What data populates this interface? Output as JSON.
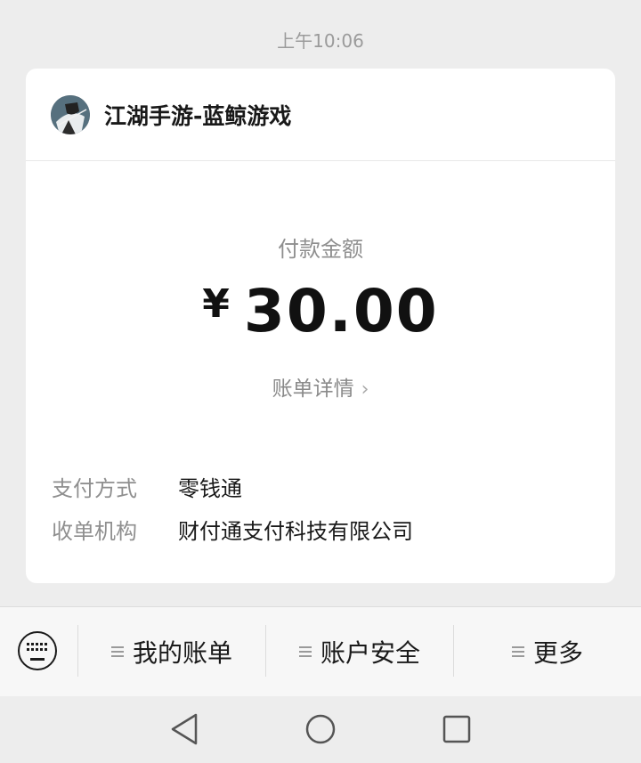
{
  "message": {
    "time": "上午10:06"
  },
  "merchant": {
    "name": "江湖手游-蓝鲸游戏"
  },
  "payment": {
    "amount_label": "付款金额",
    "currency_symbol": "¥",
    "amount": "30.00",
    "bill_details_link": "账单详情"
  },
  "info": [
    {
      "key": "支付方式",
      "value": "零钱通"
    },
    {
      "key": "收单机构",
      "value": "财付通支付科技有限公司"
    }
  ],
  "menu": {
    "items": [
      {
        "label": "我的账单"
      },
      {
        "label": "账户安全"
      },
      {
        "label": "更多"
      }
    ]
  },
  "icons": {
    "keyboard": "keyboard-icon",
    "back": "back-triangle-icon",
    "home": "home-circle-icon",
    "recents": "recents-square-icon"
  }
}
